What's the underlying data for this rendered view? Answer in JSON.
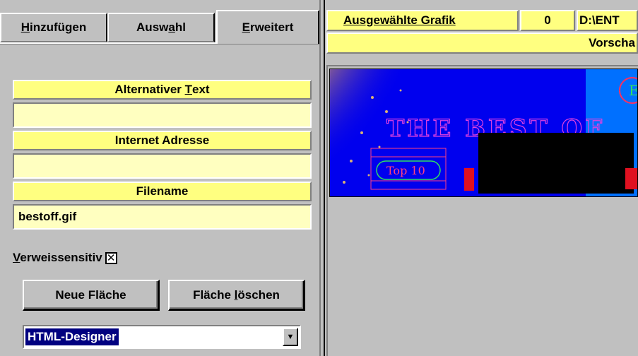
{
  "tabs": [
    {
      "label": "Hinzufügen",
      "mnemonic": "H",
      "rest": "inzufügen"
    },
    {
      "label": "Auswahl",
      "pre": "Ausw",
      "mnemonic": "a",
      "rest": "hl"
    },
    {
      "label": "Erweitert",
      "mnemonic": "E",
      "rest": "rweitert"
    }
  ],
  "fields": {
    "alt_text_label_pre": "Alternativer ",
    "alt_text_label_mn": "T",
    "alt_text_label_post": "ext",
    "alt_text_value": "",
    "internet_label": "Internet Adresse",
    "internet_value": "",
    "filename_label": "Filename",
    "filename_value": "bestoff.gif"
  },
  "checkbox": {
    "label_mn": "V",
    "label_rest": "erweissensitiv",
    "checked_glyph": "✕"
  },
  "buttons": {
    "new_area": "Neue Fläche",
    "delete_area_pre": "Fläche ",
    "delete_area_mn": "l",
    "delete_area_post": "öschen"
  },
  "dropdown": {
    "selected": "HTML-Designer",
    "arrow": "▼"
  },
  "right": {
    "selected_graphic_label": "Ausgewählte Grafik",
    "index_value": "0",
    "path": "D:\\ENT",
    "preview_label": "Vorscha"
  },
  "banner": {
    "headline": "THE BEST OF",
    "button_text": "Top 10",
    "corner_letter": "E"
  },
  "colors": {
    "panel": "#c0c0c0",
    "field_header": "#ffff80",
    "field_input": "#ffffc0",
    "selection": "#000080",
    "banner_bg": "#0000ee"
  }
}
